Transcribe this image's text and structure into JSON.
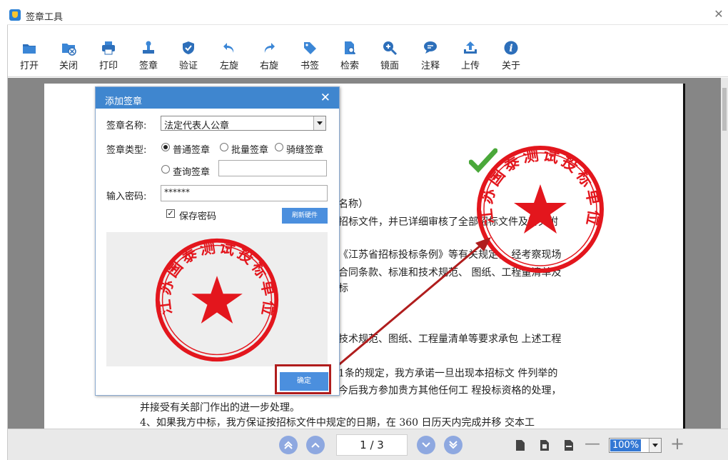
{
  "window": {
    "title": "签章工具"
  },
  "toolbar": [
    {
      "label": "打开",
      "icon": "folder-open-icon"
    },
    {
      "label": "关闭",
      "icon": "folder-close-icon"
    },
    {
      "label": "打印",
      "icon": "printer-icon"
    },
    {
      "label": "签章",
      "icon": "stamp-icon"
    },
    {
      "label": "验证",
      "icon": "shield-check-icon"
    },
    {
      "label": "左旋",
      "icon": "rotate-left-icon"
    },
    {
      "label": "右旋",
      "icon": "rotate-right-icon"
    },
    {
      "label": "书签",
      "icon": "bookmark-tag-icon"
    },
    {
      "label": "检索",
      "icon": "search-document-icon"
    },
    {
      "label": "镜面",
      "icon": "zoom-in-icon"
    },
    {
      "label": "注释",
      "icon": "comment-icon"
    },
    {
      "label": "上传",
      "icon": "upload-icon"
    },
    {
      "label": "关于",
      "icon": "info-icon"
    }
  ],
  "document": {
    "lines": [
      "名称）",
      "招标文件，并已详细审核了全部招标文件及有关附",
      "《江苏省招标投标条例》等有关规定， 经考察现场",
      "合同条款、标准和技术规范、 图纸、工程量清单及",
      "标",
      "技术规范、图纸、工程量清单等要求承包 上述工程",
      "1条的规定，我方承诺一旦出现本招标文 件列举的",
      "今后我方参加贵方其他任何工 程投标资格的处理，",
      "并接受有关部门作出的进一步处理。",
      "4、如果我方中标，我方保证按招标文件中规定的日期，在 360 日历天内完成并移 交本工"
    ],
    "stamp_text": "江苏国泰测试投标单位3"
  },
  "dialog": {
    "title": "添加签章",
    "name_label": "签章名称:",
    "name_value": "法定代表人公章",
    "type_label": "签章类型:",
    "type_options": [
      "普通签章",
      "批量签章",
      "骑缝签章",
      "查询签章"
    ],
    "type_selected": "普通签章",
    "password_label": "输入密码:",
    "password_value": "******",
    "save_password_label": "保存密码",
    "save_password_checked": true,
    "refresh_button": "刷新硬件",
    "ok_button": "确定",
    "preview_stamp_text": "江苏国泰测试投标单位3"
  },
  "navbar": {
    "page_indicator": "1 / 3",
    "zoom": "100%"
  },
  "colors": {
    "accent": "#3f86cf",
    "stamp_red": "#e3161d",
    "annotation_red": "#b01d1d",
    "check_green": "#4aa83a"
  }
}
